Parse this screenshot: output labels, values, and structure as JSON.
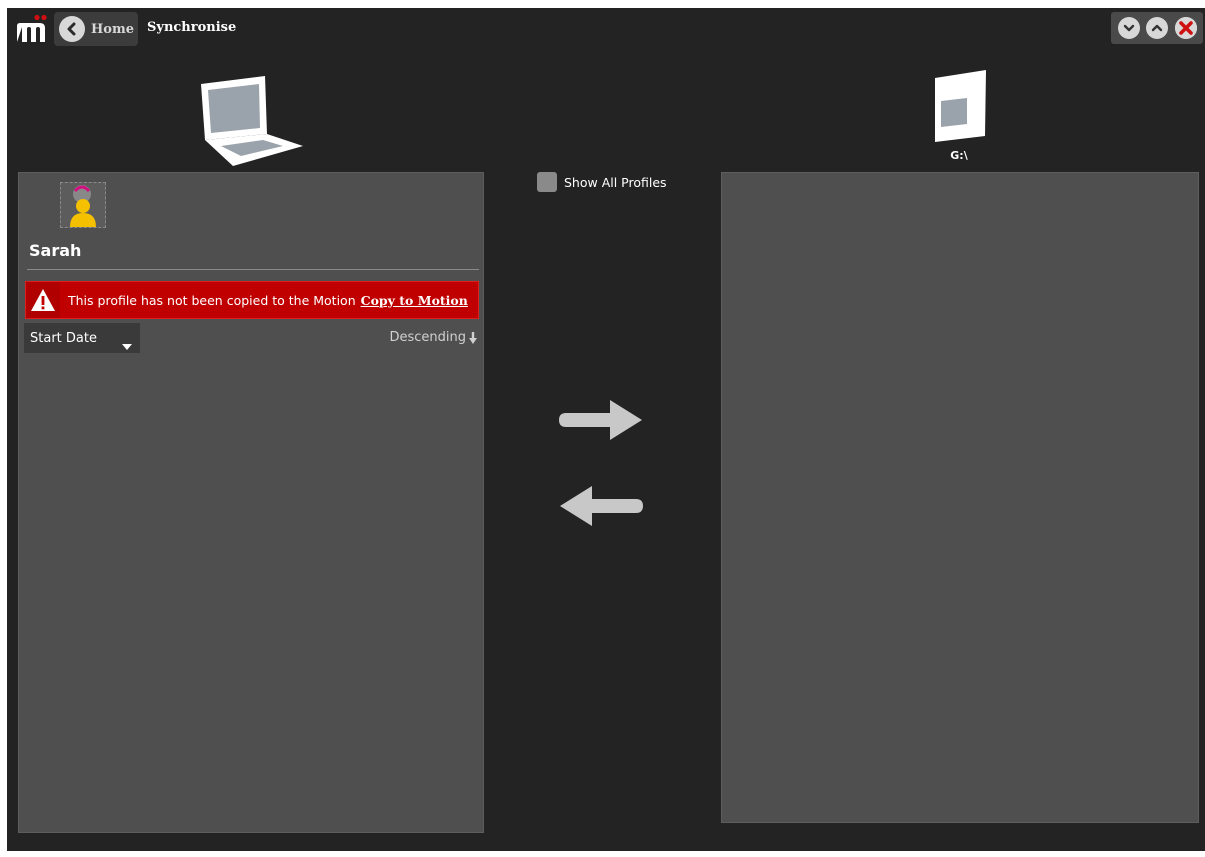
{
  "app": {
    "logo": "m",
    "accent_color": "#c00000"
  },
  "header": {
    "back_label": "Home",
    "title": "Synchronise"
  },
  "window_controls": [
    "chevron-down-icon",
    "chevron-up-icon",
    "close-icon"
  ],
  "devices": {
    "local": "laptop-icon",
    "remote": "tablet-icon",
    "remote_drive": "G:\\"
  },
  "left_panel": {
    "profile_name": "Sarah",
    "warning": {
      "message": "This profile has not been copied to the Motion",
      "action": "Copy to Motion"
    },
    "sort": {
      "field": "Start Date",
      "order": "Descending"
    }
  },
  "center": {
    "show_all_label": "Show All Profiles",
    "show_all_checked": false
  }
}
